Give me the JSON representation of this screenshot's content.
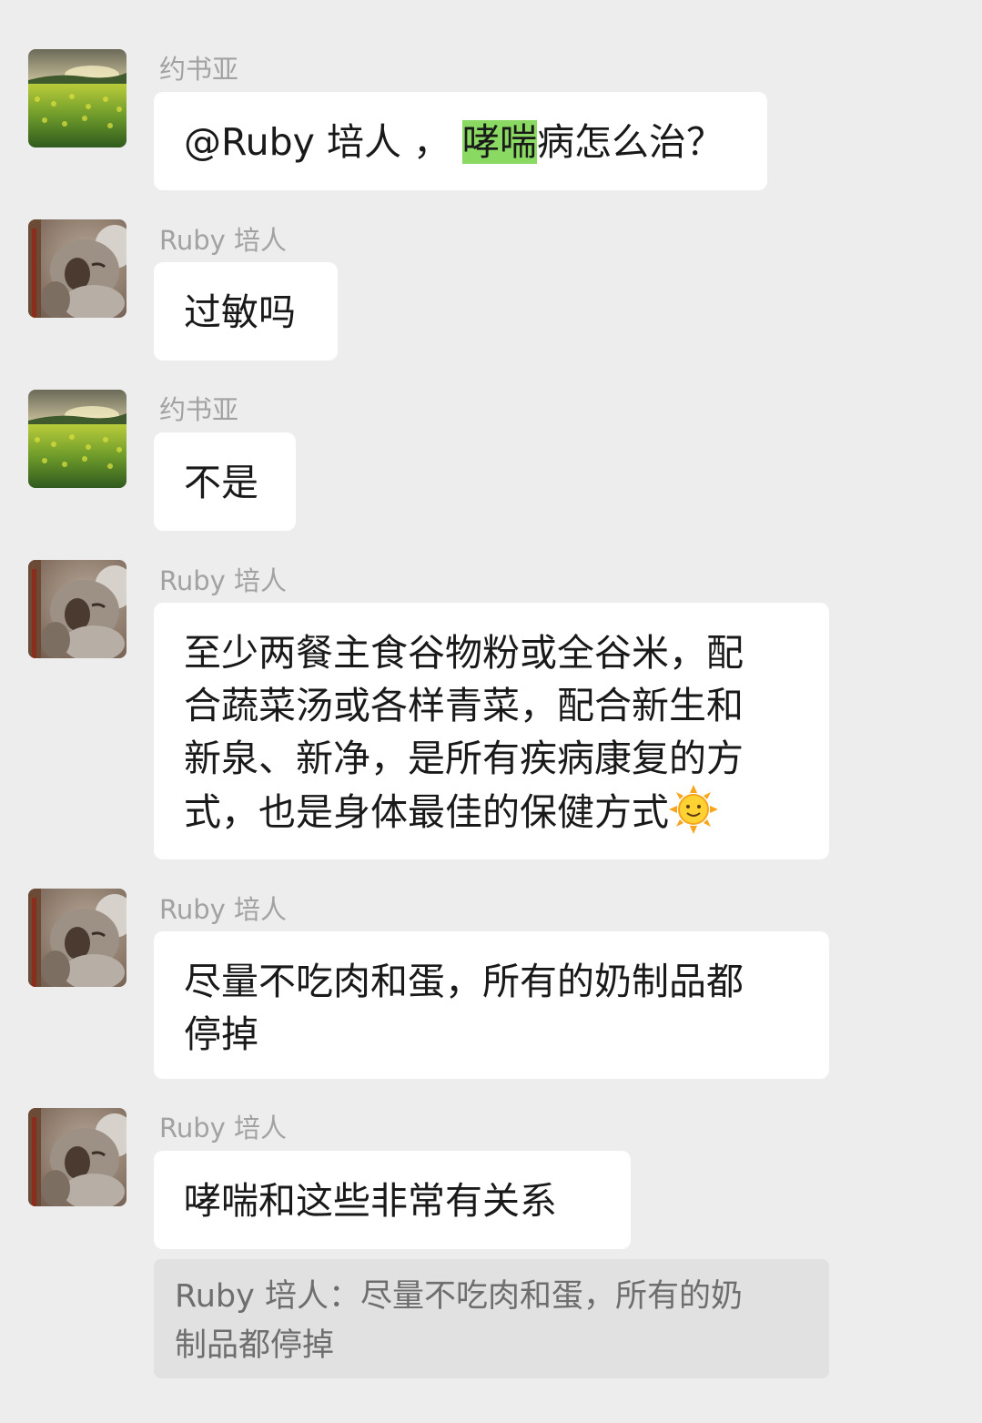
{
  "messages": [
    {
      "sender": "约书亚",
      "avatar": "field-avatar",
      "lines": [
        {
          "pre": "@Ruby 培人 ， ",
          "highlight": "哮喘",
          "post": "病怎么治？"
        }
      ]
    },
    {
      "sender": "Ruby 培人",
      "avatar": "koala-avatar",
      "lines": [
        "过敏吗"
      ]
    },
    {
      "sender": "约书亚",
      "avatar": "field-avatar",
      "lines": [
        "不是"
      ]
    },
    {
      "sender": "Ruby 培人",
      "avatar": "koala-avatar",
      "lines": [
        "至少两餐主食谷物粉或全谷米，配",
        "合蔬菜汤或各样青菜，配合新生和",
        "新泉、新净，是所有疾病康复的方",
        "式，也是身体最佳的保健方式"
      ],
      "trailing_emoji": "sun-with-face"
    },
    {
      "sender": "Ruby 培人",
      "avatar": "koala-avatar",
      "lines": [
        "尽量不吃肉和蛋，所有的奶制品都",
        "停掉"
      ]
    },
    {
      "sender": "Ruby 培人",
      "avatar": "koala-avatar",
      "lines": [
        "哮喘和这些非常有关系"
      ]
    }
  ],
  "quote": {
    "lines": [
      "Ruby 培人：尽量不吃肉和蛋，所有的奶",
      "制品都停掉"
    ]
  },
  "colors": {
    "background": "#ededed",
    "bubble": "#ffffff",
    "highlight": "#89d962",
    "sender_text": "#a2a2a2",
    "quote_background": "#e1e1e1"
  }
}
